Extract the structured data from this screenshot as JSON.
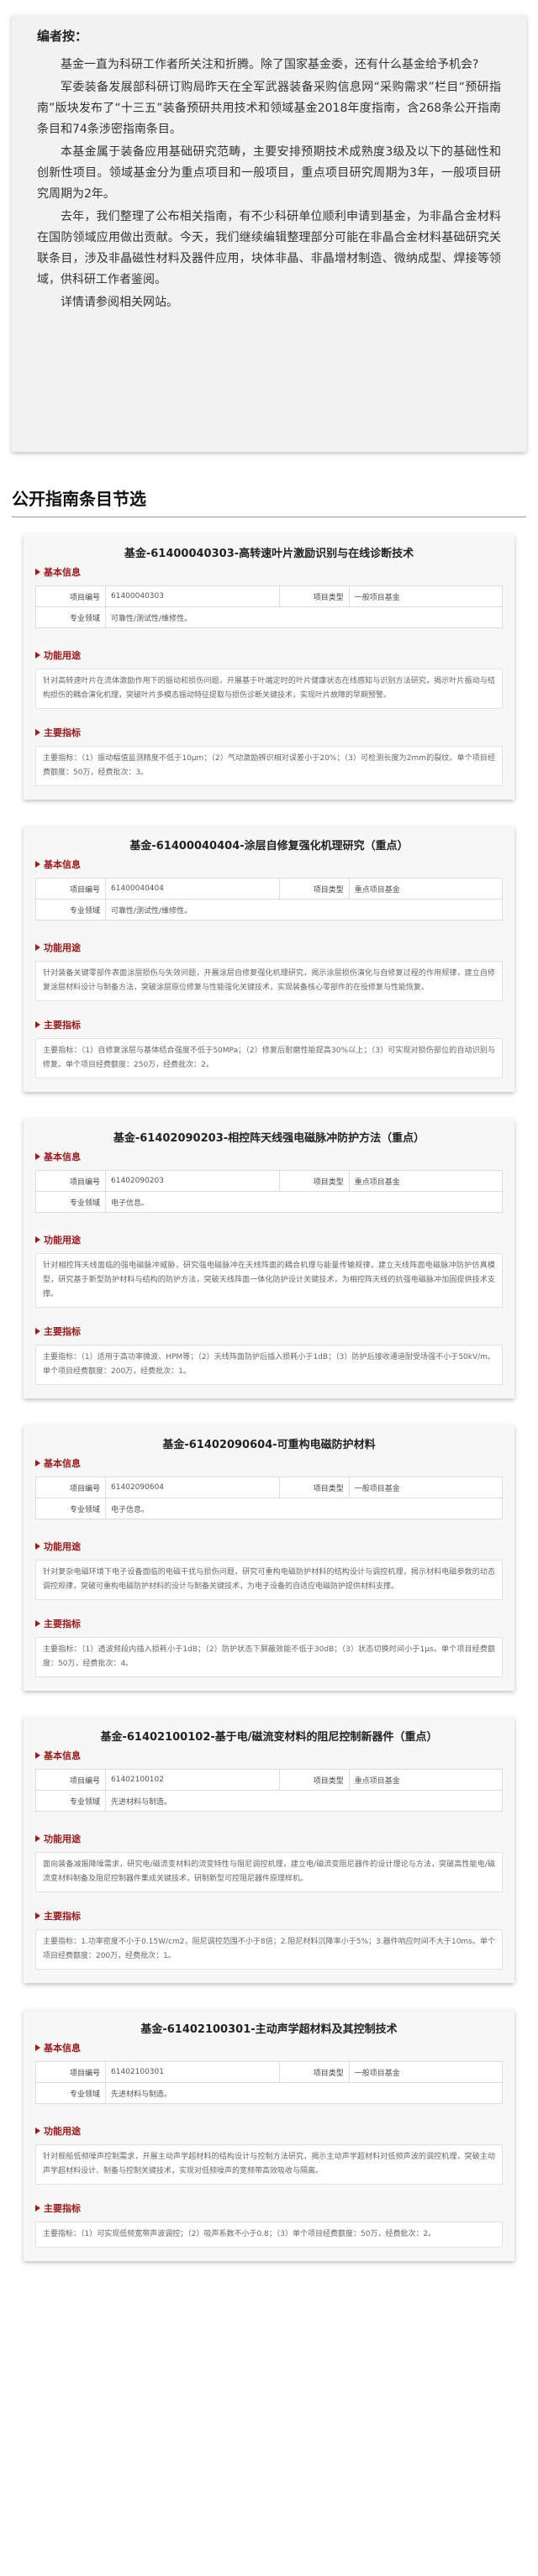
{
  "intro": {
    "title": "编者按：",
    "paragraphs": [
      "基金一直为科研工作者所关注和折腾。除了国家基金委，还有什么基金给予机会?",
      "军委装备发展部科研订购局昨天在全军武器装备采购信息网“采购需求”栏目“预研指南”版块发布了“十三五”装备预研共用技术和领域基金2018年度指南，含268条公开指南条目和74条涉密指南条目。",
      "本基金属于装备应用基础研究范畴，主要安排预期技术成熟度3级及以下的基础性和创新性项目。领域基金分为重点项目和一般项目，重点项目研究周期为3年，一般项目研究周期为2年。",
      "去年，我们整理了公布相关指南，有不少科研单位顺利申请到基金，为非晶合金材料在国防领域应用做出贡献。今天，我们继续编辑整理部分可能在非晶合金材料基础研究关联条目，涉及非晶磁性材料及器件应用，块体非晶、非晶增材制造、微纳成型、焊接等领域，供科研工作者鉴阅。",
      "详情请参阅相关网站。"
    ]
  },
  "section_heading": "公开指南条目节选",
  "labels": {
    "basic_info": "基本信息",
    "project_no": "项目编号",
    "project_type": "项目类型",
    "domain": "专业领域",
    "function": "功能用途",
    "main_index": "主要指标"
  },
  "items": [
    {
      "title": "基金-61400040303-高转速叶片激励识别与在线诊断技术",
      "no": "61400040303",
      "type": "一般项目基金",
      "domain": "可靠性/测试性/维修性。",
      "function": "针对高转速叶片在流体激励作用下的振动和损伤问题，开展基于叶端定时的叶片健康状态在线感知与识别方法研究，揭示叶片振动与结构损伤的耦合演化机理，突破叶片多模态振动特征提取与损伤诊断关键技术，实现叶片故障的早期预警。",
      "index": "主要指标：（1）振动幅值监测精度不低于10μm；（2）气动激励辨识相对误差小于20%；（3）可检测长度为2mm的裂纹。单个项目经费额度：50万，经费批次：3。"
    },
    {
      "title": "基金-61400040404-涂层自修复强化机理研究（重点）",
      "no": "61400040404",
      "type": "重点项目基金",
      "domain": "可靠性/测试性/维修性。",
      "function": "针对装备关键零部件表面涂层损伤与失效问题，开展涂层自修复强化机理研究，揭示涂层损伤演化与自修复过程的作用规律，建立自修复涂层材料设计与制备方法，突破涂层原位修复与性能强化关键技术，实现装备核心零部件的在役修复与性能恢复。",
      "index": "主要指标：（1）自修复涂层与基体结合强度不低于50MPa；（2）修复后耐磨性能提高30%以上；（3）可实现对损伤部位的自动识别与修复。单个项目经费额度：250万，经费批次：2。"
    },
    {
      "title": "基金-61402090203-相控阵天线强电磁脉冲防护方法（重点）",
      "no": "61402090203",
      "type": "重点项目基金",
      "domain": "电子信息。",
      "function": "针对相控阵天线面临的强电磁脉冲威胁，研究强电磁脉冲在天线阵面的耦合机理与能量传输规律，建立天线阵面电磁脉冲防护仿真模型，研究基于新型防护材料与结构的防护方法，突破天线阵面一体化防护设计关键技术，为相控阵天线的抗强电磁脉冲加固提供技术支撑。",
      "index": "主要指标：（1）适用于高功率微波、HPM等；（2）天线阵面防护后插入损耗小于1dB；（3）防护后接收通道耐受场强不小于50kV/m。单个项目经费额度：200万，经费批次：1。"
    },
    {
      "title": "基金-61402090604-可重构电磁防护材料",
      "no": "61402090604",
      "type": "一般项目基金",
      "domain": "电子信息。",
      "function": "针对复杂电磁环境下电子设备面临的电磁干扰与损伤问题，研究可重构电磁防护材料的结构设计与调控机理，揭示材料电磁参数的动态调控规律，突破可重构电磁防护材料的设计与制备关键技术，为电子设备的自适应电磁防护提供材料支撑。",
      "index": "主要指标：（1）透波频段内插入损耗小于1dB；（2）防护状态下屏蔽效能不低于30dB；（3）状态切换时间小于1μs。单个项目经费额度：50万，经费批次：4。"
    },
    {
      "title": "基金-61402100102-基于电/磁流变材料的阻尼控制新器件（重点）",
      "no": "61402100102",
      "type": "重点项目基金",
      "domain": "先进材料与制造。",
      "function": "面向装备减振降噪需求，研究电/磁流变材料的流变特性与阻尼调控机理，建立电/磁流变阻尼器件的设计理论与方法，突破高性能电/磁流变材料制备及阻尼控制器件集成关键技术，研制新型可控阻尼器件原理样机。",
      "index": "主要指标：1.功率密度不小于0.15W/cm2，阻尼调控范围不小于8倍；2.阻尼材料沉降率小于5%；3.器件响应时间不大于10ms。单个项目经费额度：200万，经费批次：1。"
    },
    {
      "title": "基金-61402100301-主动声学超材料及其控制技术",
      "no": "61402100301",
      "type": "一般项目基金",
      "domain": "先进材料与制造。",
      "function": "针对舰船低频噪声控制需求，开展主动声学超材料的结构设计与控制方法研究，揭示主动声学超材料对低频声波的调控机理，突破主动声学超材料设计、制备与控制关键技术，实现对低频噪声的宽频带高效吸收与隔离。",
      "index": "主要指标：（1）可实现低频宽带声波调控；（2）吸声系数不小于0.8；（3）单个项目经费额度：50万，经费批次：2。"
    }
  ]
}
